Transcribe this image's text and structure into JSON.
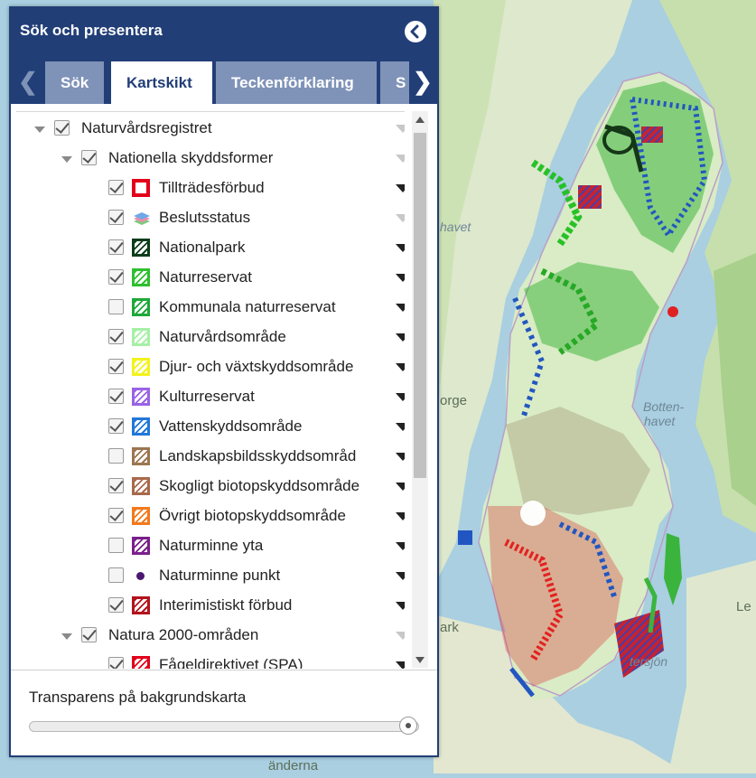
{
  "map": {
    "labels": [
      "havet",
      "Botten-",
      "havet",
      "orge",
      "ark",
      "Le",
      "änderna",
      "tersjön"
    ]
  },
  "panel": {
    "title": "Sök och presentera",
    "tabs": [
      {
        "label": "Sök",
        "active": false
      },
      {
        "label": "Kartskikt",
        "active": true
      },
      {
        "label": "Teckenförklaring",
        "active": false
      },
      {
        "label": "S",
        "active": false
      }
    ],
    "tab_prev": "❮",
    "tab_next": "❯",
    "layers": [
      {
        "label": "Naturvårdsregistret",
        "checked": true,
        "level": 0,
        "expandable": true,
        "symbol": "",
        "menu_enabled": false
      },
      {
        "label": "Nationella skyddsformer",
        "checked": true,
        "level": 1,
        "expandable": true,
        "symbol": "",
        "menu_enabled": false
      },
      {
        "label": "Tillträdesförbud",
        "checked": true,
        "level": 2,
        "symbol": "red-box",
        "color": "#e3001b",
        "menu_enabled": true
      },
      {
        "label": "Beslutsstatus",
        "checked": true,
        "level": 2,
        "symbol": "layers-icon",
        "menu_enabled": false
      },
      {
        "label": "Nationalpark",
        "checked": true,
        "level": 2,
        "symbol": "hatch",
        "color": "#0b3d1a",
        "menu_enabled": true
      },
      {
        "label": "Naturreservat",
        "checked": true,
        "level": 2,
        "symbol": "hatch",
        "color": "#2fbf2f",
        "menu_enabled": true
      },
      {
        "label": "Kommunala naturreservat",
        "checked": false,
        "level": 2,
        "symbol": "hatch",
        "color": "#1fa83a",
        "menu_enabled": true
      },
      {
        "label": "Naturvårdsområde",
        "checked": true,
        "level": 2,
        "symbol": "hatch",
        "color": "#a6f0a6",
        "menu_enabled": true
      },
      {
        "label": "Djur- och växtskyddsområde",
        "checked": true,
        "level": 2,
        "symbol": "hatch",
        "color": "#f2f21e",
        "menu_enabled": true
      },
      {
        "label": "Kulturreservat",
        "checked": true,
        "level": 2,
        "symbol": "hatch",
        "color": "#9a63e6",
        "menu_enabled": true
      },
      {
        "label": "Vattenskyddsområde",
        "checked": true,
        "level": 2,
        "symbol": "hatch",
        "color": "#2277d9",
        "menu_enabled": true
      },
      {
        "label": "Landskapsbildsskyddsområd",
        "checked": false,
        "level": 2,
        "symbol": "hatch",
        "color": "#9b7650",
        "menu_enabled": true
      },
      {
        "label": "Skogligt biotopskyddsområde",
        "checked": true,
        "level": 2,
        "symbol": "hatch",
        "color": "#a86a4c",
        "menu_enabled": true
      },
      {
        "label": "Övrigt biotopskyddsområde",
        "checked": true,
        "level": 2,
        "symbol": "hatch",
        "color": "#f27a1d",
        "menu_enabled": true
      },
      {
        "label": "Naturminne yta",
        "checked": false,
        "level": 2,
        "symbol": "hatch",
        "color": "#7a1f8c",
        "menu_enabled": true
      },
      {
        "label": "Naturminne punkt",
        "checked": false,
        "level": 2,
        "symbol": "dot",
        "color": "#4a1870",
        "menu_enabled": true
      },
      {
        "label": "Interimistiskt förbud",
        "checked": true,
        "level": 2,
        "symbol": "hatch",
        "color": "#b3131d",
        "menu_enabled": true
      },
      {
        "label": "Natura 2000-områden",
        "checked": true,
        "level": 1,
        "expandable": true,
        "symbol": "",
        "menu_enabled": false
      },
      {
        "label": "Fågeldirektivet (SPA)",
        "checked": true,
        "level": 2,
        "symbol": "hatch",
        "color": "#e3001b",
        "menu_enabled": true
      }
    ],
    "transparency_label": "Transparens på bakgrundskarta",
    "transparency_value": 1.0
  }
}
